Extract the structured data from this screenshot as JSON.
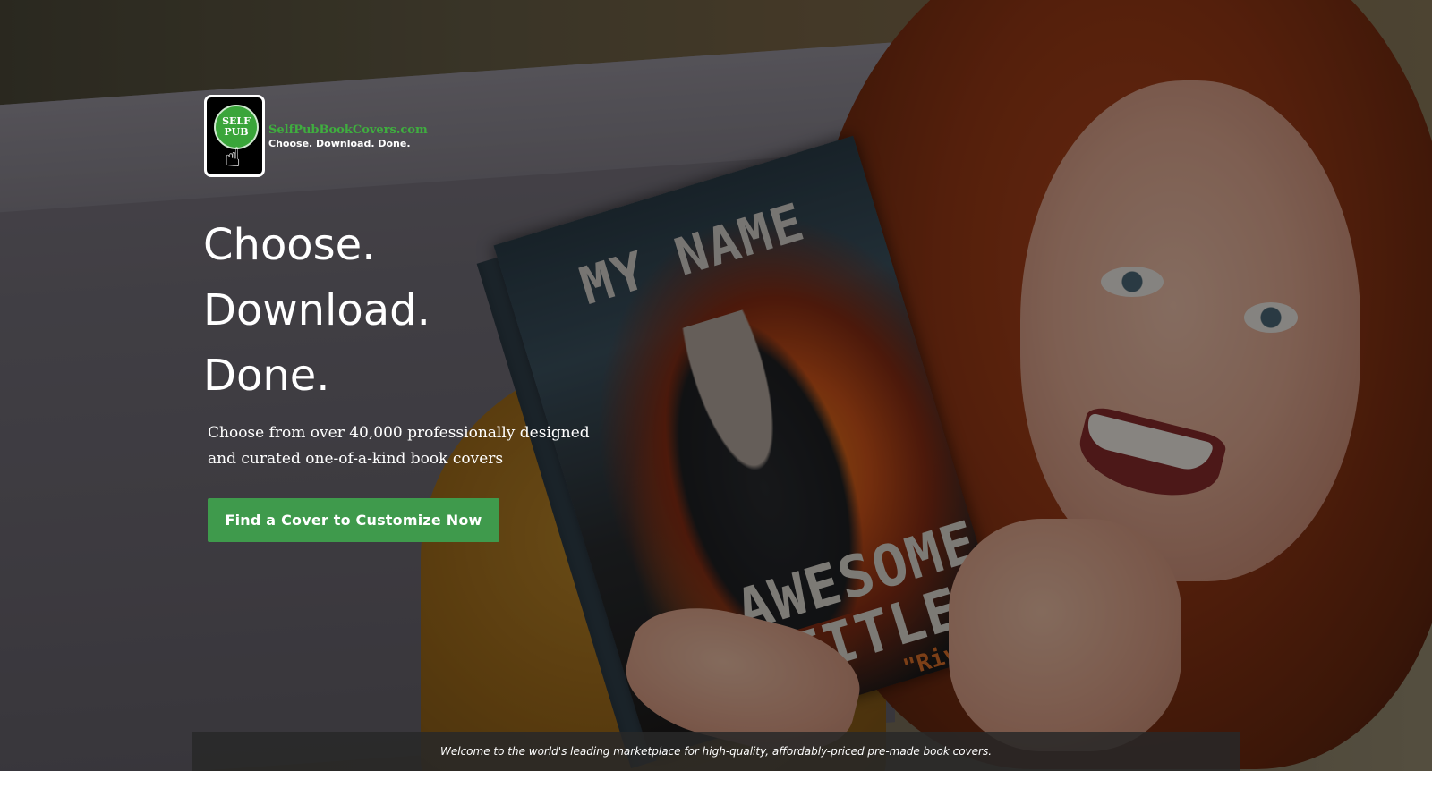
{
  "brand": {
    "logo_circle_line1": "SELF",
    "logo_circle_line2": "PUB",
    "site_name": "SelfPubBookCovers.com",
    "tagline": "Choose. Download. Done."
  },
  "hero": {
    "headline": [
      "Choose.",
      "Download.",
      "Done."
    ],
    "subtext": "Choose from over 40,000 professionally designed and curated one-of-a-kind book covers",
    "cta_label": "Find a Cover to Customize Now"
  },
  "book": {
    "author": "MY NAME",
    "title_line1": "AWESOME",
    "title_line2": "TITLE",
    "tag": "\"Rivetin"
  },
  "footer": {
    "welcome": "Welcome to the world's leading marketplace for high-quality, affordably-priced pre-made book covers."
  },
  "colors": {
    "cta_background": "#3f9a4c",
    "brand_green": "#3fae3f"
  }
}
